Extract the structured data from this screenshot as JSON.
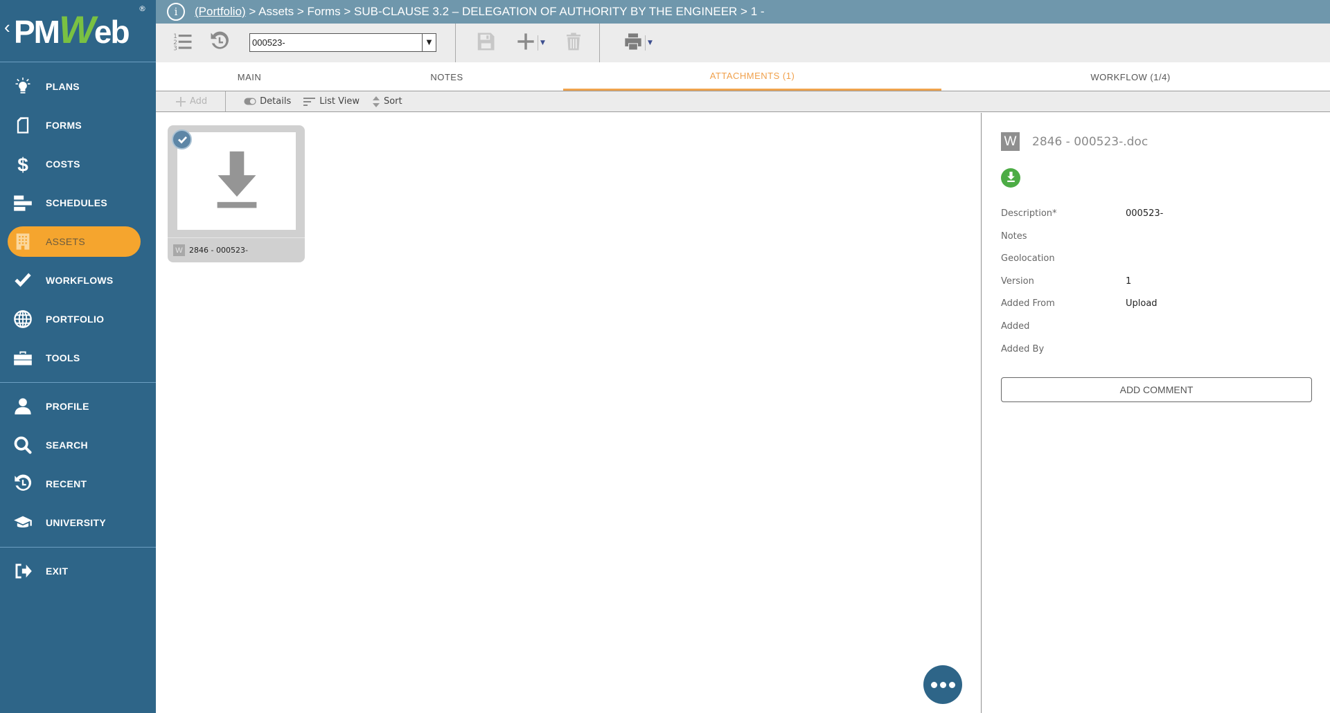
{
  "app": {
    "logo_text_1": "PM",
    "logo_text_w": "W",
    "logo_text_2": "eb",
    "logo_back": "‹",
    "logo_reg": "®"
  },
  "sidebar": {
    "items": [
      {
        "label": "PLANS",
        "icon": "lightbulb-icon"
      },
      {
        "label": "FORMS",
        "icon": "document-icon"
      },
      {
        "label": "COSTS",
        "icon": "dollar-icon"
      },
      {
        "label": "SCHEDULES",
        "icon": "gantt-bars-icon"
      },
      {
        "label": "ASSETS",
        "icon": "building-icon",
        "active": true
      },
      {
        "label": "WORKFLOWS",
        "icon": "checkmark-icon"
      },
      {
        "label": "PORTFOLIO",
        "icon": "globe-icon"
      },
      {
        "label": "TOOLS",
        "icon": "toolbox-icon"
      }
    ],
    "user_items": [
      {
        "label": "PROFILE",
        "icon": "person-icon"
      },
      {
        "label": "SEARCH",
        "icon": "search-icon"
      },
      {
        "label": "RECENT",
        "icon": "history-icon"
      },
      {
        "label": "UNIVERSITY",
        "icon": "graduation-cap-icon"
      }
    ],
    "exit": {
      "label": "EXIT",
      "icon": "exit-icon"
    }
  },
  "breadcrumb": {
    "link": "(Portfolio)",
    "path": " > Assets > Forms > SUB-CLAUSE 3.2 – DELEGATION OF AUTHORITY BY THE ENGINEER > 1 -"
  },
  "toolbar": {
    "record_select_value": "000523-"
  },
  "tabs": [
    {
      "label": "MAIN"
    },
    {
      "label": "NOTES"
    },
    {
      "label": "ATTACHMENTS (1)",
      "active": true
    },
    {
      "label": "WORKFLOW (1/4)"
    }
  ],
  "actions": {
    "add": "Add",
    "details": "Details",
    "list_view": "List View",
    "sort": "Sort"
  },
  "attachments": [
    {
      "badge": "W",
      "name": "2846 - 000523-",
      "selected": true
    }
  ],
  "details": {
    "badge": "W",
    "file_name": "2846 - 000523-.doc",
    "fields": [
      {
        "label": "Description*",
        "value": "000523-"
      },
      {
        "label": "Notes",
        "value": ""
      },
      {
        "label": "Geolocation",
        "value": ""
      },
      {
        "label": "Version",
        "value": "1"
      },
      {
        "label": "Added From",
        "value": "Upload"
      },
      {
        "label": "Added",
        "value": ""
      },
      {
        "label": "Added By",
        "value": ""
      }
    ],
    "add_comment_label": "ADD COMMENT"
  },
  "colors": {
    "sidebar": "#2e6588",
    "active_nav": "#f5a52e",
    "topbar": "#6f97ac",
    "active_tab": "#f0a04b",
    "download_green": "#4cac45"
  }
}
